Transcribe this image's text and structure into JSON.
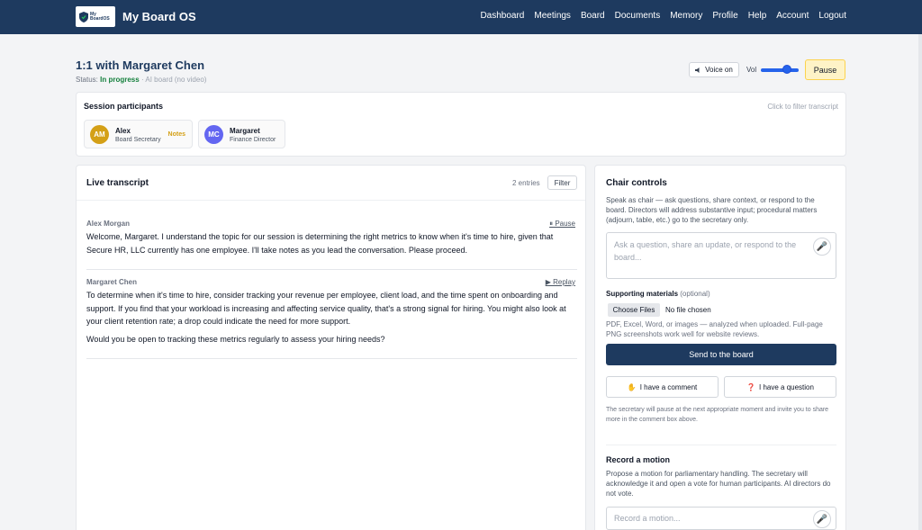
{
  "app": {
    "brand": "My Board OS",
    "logo_text_top": "My",
    "logo_text_bottom": "BoardOS"
  },
  "nav": {
    "items": [
      "Dashboard",
      "Meetings",
      "Board",
      "Documents",
      "Memory",
      "Profile",
      "Help",
      "Account",
      "Logout"
    ]
  },
  "header": {
    "title": "1:1 with Margaret Chen",
    "status_label": "Status:",
    "status_value": "In progress",
    "mode": "· AI board (no video)",
    "voice_label": "Voice on",
    "vol_label": "Vol",
    "volume_level": 0.75,
    "pause_label": "Pause"
  },
  "participants": {
    "heading": "Session participants",
    "hint": "Click to filter transcript",
    "items": [
      {
        "initials": "AM",
        "name": "Alex",
        "role": "Board Secretary",
        "tag": "Notes",
        "color": "#d4a017"
      },
      {
        "initials": "MC",
        "name": "Margaret",
        "role": "Finance Director",
        "tag": "",
        "color": "#6366f1"
      }
    ]
  },
  "transcript": {
    "heading": "Live transcript",
    "count": "2 entries",
    "filter_label": "Filter",
    "entries": [
      {
        "speaker": "Alex Morgan",
        "action": "⏸ Pause",
        "paragraphs": [
          "Welcome, Margaret. I understand the topic for our session is determining the right metrics to know when it's time to hire, given that Secure HR, LLC currently has one employee. I'll take notes as you lead the conversation. Please proceed."
        ]
      },
      {
        "speaker": "Margaret Chen",
        "action": "▶ Replay",
        "paragraphs": [
          "To determine when it's time to hire, consider tracking your revenue per employee, client load, and the time spent on onboarding and support. If you find that your workload is increasing and affecting service quality, that's a strong signal for hiring. You might also look at your client retention rate; a drop could indicate the need for more support.",
          "Would you be open to tracking these metrics regularly to assess your hiring needs?"
        ]
      }
    ]
  },
  "chair": {
    "heading": "Chair controls",
    "description": "Speak as chair — ask questions, share context, or respond to the board. Directors will address substantive input; procedural matters (adjourn, table, etc.) go to the secretary only.",
    "input_placeholder": "Ask a question, share an update, or respond to the board...",
    "materials_label": "Supporting materials",
    "materials_optional": "(optional)",
    "choose_files": "Choose Files",
    "no_file": "No file chosen",
    "materials_help": "PDF, Excel, Word, or images — analyzed when uploaded. Full-page PNG screenshots work well for website reviews.",
    "send_label": "Send to the board",
    "comment_icon": "✋",
    "comment_label": "I have a comment",
    "question_icon": "❓",
    "question_label": "I have a question",
    "pause_note": "The secretary will pause at the next appropriate moment and invite you to share more in the comment box above.",
    "motion_title": "Record a motion",
    "motion_desc": "Propose a motion for parliamentary handling. The secretary will acknowledge it and open a vote for human participants. AI directors do not vote.",
    "motion_placeholder": "Record a motion..."
  },
  "colors": {
    "navbar": "#1e3a5f",
    "status_ok": "#15803d",
    "pause_bg": "#fef3c7",
    "send_bg": "#1e3a5f"
  }
}
